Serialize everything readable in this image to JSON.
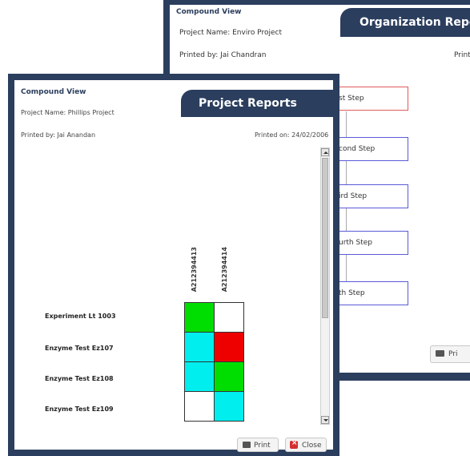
{
  "back_window": {
    "title": "Compound View",
    "project_name": "Project Name: Enviro Project",
    "printed_by": "Printed by: Jai Chandran",
    "printed_cut": "Print",
    "tab": "Organization Repo",
    "steps": [
      "st Step",
      "cond Step",
      "ird Step",
      "urth Step",
      "th Step"
    ],
    "print_label": "Pri"
  },
  "front_window": {
    "title": "Compound View",
    "project_name": "Project Name: Phillips Project",
    "printed_by": "Printed by: Jai Anandan",
    "printed_on": "Printed on: 24/02/2006",
    "tab": "Project Reports",
    "columns": [
      "A212394413",
      "A212394414"
    ],
    "rows": [
      {
        "label": "Experiment Lt 1003",
        "cells": [
          "#00dd00",
          "#ffffff"
        ]
      },
      {
        "label": "Enzyme Test Ez107",
        "cells": [
          "#00eeee",
          "#ee0000"
        ]
      },
      {
        "label": "Enzyme Test Ez108",
        "cells": [
          "#00eeee",
          "#00dd00"
        ]
      },
      {
        "label": "Enzyme Test Ez109",
        "cells": [
          "#ffffff",
          "#00eeee"
        ]
      }
    ],
    "print_button": "Print",
    "close_button": "Close"
  }
}
